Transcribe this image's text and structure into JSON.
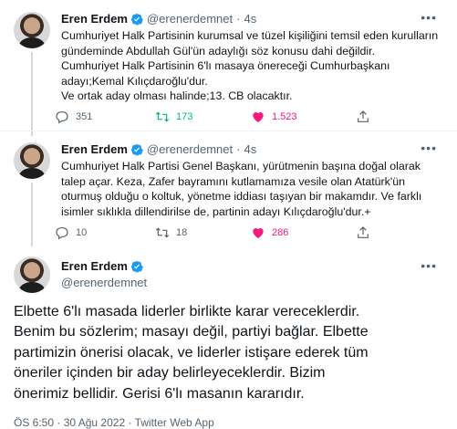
{
  "author": {
    "name": "Eren Erdem",
    "handle": "@erenerdemnet"
  },
  "tweets": [
    {
      "time": "4s",
      "lines": [
        "Cumhuriyet Halk Partisinin kurumsal ve tüzel kişiliğini temsil eden kurulların",
        "gündeminde Abdullah Gül'ün adaylığı söz konusu dahi değildir.",
        "Cumhuriyet Halk Partisinin 6'lı masaya önereceği Cumhurbaşkanı",
        "adayı;Kemal Kılıçdaroğlu'dur.",
        "Ve ortak aday olması halinde;13. CB olacaktır."
      ],
      "replies": "351",
      "retweets": "173",
      "likes": "1.523"
    },
    {
      "time": "4s",
      "lines": [
        "Cumhuriyet Halk Partisi Genel Başkanı, yürütmenin başına doğal olarak",
        "talep açar. Keza, Zafer bayramını kutlamamıza vesile olan Atatürk'ün",
        "oturmuş olduğu o koltuk, yönetme iddiası taşıyan bir makamdır. Ve farklı",
        "isimler sıklıkla dillendirilse de, partinin adayı Kılıçdaroğlu'dur.+"
      ],
      "replies": "10",
      "retweets": "18",
      "likes": "286"
    }
  ],
  "main_tweet": {
    "lines": [
      "Elbette 6'lı masada liderler birlikte karar vereceklerdir.",
      "Benim bu sözlerim; masayı değil, partiyi bağlar. Elbette",
      "partimizin önerisi olacak, ve liderler istişare ederek tüm",
      "öneriler içinden bir aday belirleyeceklerdir. Bizim",
      "önerimiz bellidir. Gerisi 6'lı masanın kararıdır."
    ],
    "time": "ÖS 6:50",
    "date": "30 Ağu 2022",
    "source": "Twitter Web App"
  },
  "icons": {
    "verified": "verified-badge-icon",
    "more": "more-icon",
    "reply": "reply-icon",
    "retweet": "retweet-icon",
    "like": "heart-icon",
    "share": "share-icon"
  },
  "colors": {
    "verified": "#1d9bf0",
    "retweet_active": "#00ba7c",
    "like_active": "#f91880",
    "muted": "#536471"
  },
  "separators": {
    "dot": "·"
  }
}
